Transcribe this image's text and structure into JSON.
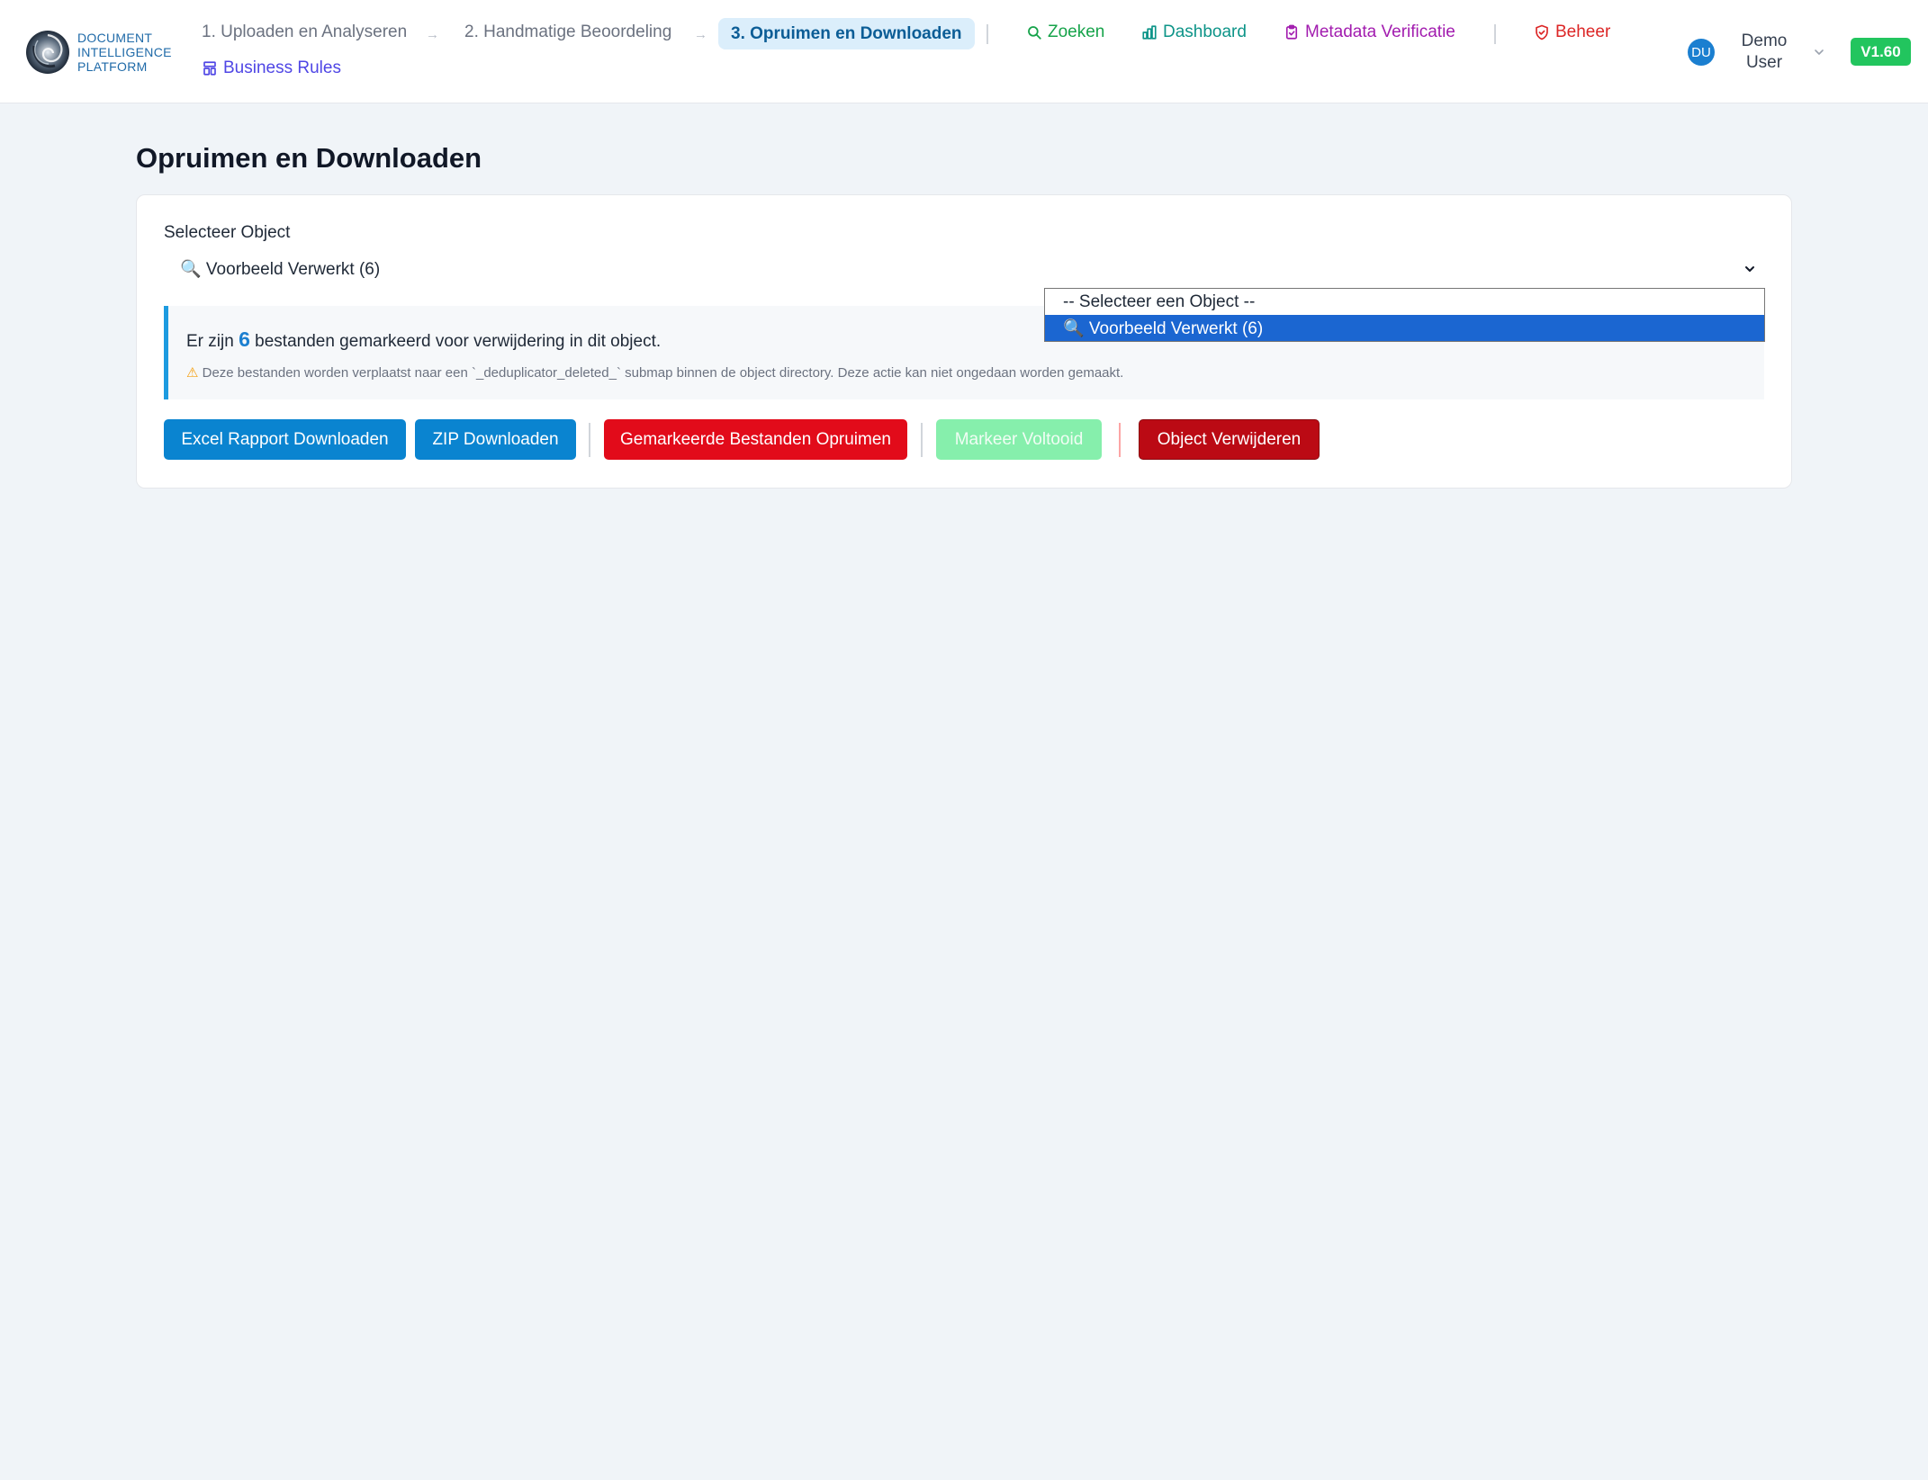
{
  "app": {
    "logo_lines": [
      "DOCUMENT",
      "INTELLIGENCE",
      "PLATFORM"
    ],
    "version": "V1.60"
  },
  "nav": {
    "steps": [
      {
        "label": "1. Uploaden en Analyseren",
        "active": false
      },
      {
        "label": "2. Handmatige Beoordeling",
        "active": false
      },
      {
        "label": "3. Opruimen en Downloaden",
        "active": true
      }
    ],
    "arrow": "→",
    "links": [
      {
        "label": "Zoeken",
        "icon": "search-icon",
        "color": "#16a34a"
      },
      {
        "label": "Dashboard",
        "icon": "bar-chart-icon",
        "color": "#0d9488"
      },
      {
        "label": "Metadata Verificatie",
        "icon": "clipboard-check-icon",
        "color": "#a21caf"
      },
      {
        "label": "Beheer",
        "icon": "shield-check-icon",
        "color": "#dc2626"
      },
      {
        "label": "Business Rules",
        "icon": "layout-icon",
        "color": "#4f46e5"
      }
    ]
  },
  "user": {
    "initials": "DU",
    "name_line1": "Demo",
    "name_line2": "User"
  },
  "main": {
    "title": "Opruimen en Downloaden",
    "select_label": "Selecteer Object",
    "select_value": "🔍 Voorbeeld Verwerkt (6)",
    "dropdown_options": [
      {
        "label": "-- Selecteer een Object --",
        "selected": false
      },
      {
        "label": "🔍 Voorbeeld Verwerkt (6)",
        "selected": true
      }
    ],
    "notice": {
      "prefix": "Er zijn",
      "count": "6",
      "suffix": "bestanden gemarkeerd voor verwijdering in dit object.",
      "warning_icon": "⚠",
      "warning": "Deze bestanden worden verplaatst naar een `_deduplicator_deleted_` submap binnen de object directory. Deze actie kan niet ongedaan worden gemaakt."
    },
    "buttons": {
      "excel": "Excel Rapport Downloaden",
      "zip": "ZIP Downloaden",
      "cleanup": "Gemarkeerde Bestanden Opruimen",
      "mark_done": "Markeer Voltooid",
      "delete_object": "Object Verwijderen"
    }
  },
  "colors": {
    "accent_blue": "#0a84d0",
    "danger_red": "#e20b1a",
    "success_green": "#22c55e"
  }
}
